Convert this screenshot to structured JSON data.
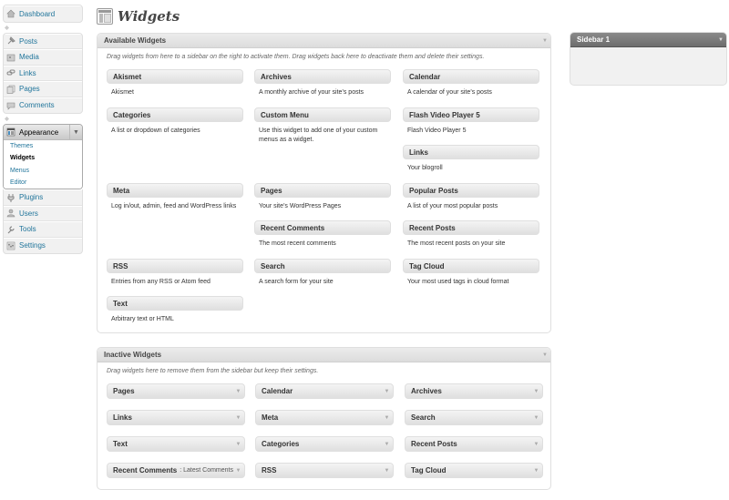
{
  "menu": {
    "dashboard": "Dashboard",
    "posts": "Posts",
    "media": "Media",
    "links": "Links",
    "pages": "Pages",
    "comments": "Comments",
    "appearance": "Appearance",
    "appearance_toggle": "▼",
    "submenu": [
      "Themes",
      "Widgets",
      "Menus",
      "Editor"
    ],
    "plugins": "Plugins",
    "users": "Users",
    "tools": "Tools",
    "settings": "Settings"
  },
  "page": {
    "title": "Widgets"
  },
  "available": {
    "title": "Available Widgets",
    "toggle": "▼",
    "description": "Drag widgets from here to a sidebar on the right to activate them. Drag widgets back here to deactivate them and delete their settings.",
    "widgets": [
      {
        "name": "Akismet",
        "desc": "Akismet"
      },
      {
        "name": "Archives",
        "desc": "A monthly archive of your site’s posts"
      },
      {
        "name": "Calendar",
        "desc": "A calendar of your site’s posts"
      },
      {
        "name": "Categories",
        "desc": "A list or dropdown of categories"
      },
      {
        "name": "Custom Menu",
        "desc": "Use this widget to add one of your custom menus as a widget."
      },
      {
        "name": "Flash Video Player 5",
        "desc": "Flash Video Player 5"
      },
      {
        "name": "Links",
        "desc": "Your blogroll"
      },
      {
        "name": "Meta",
        "desc": "Log in/out, admin, feed and WordPress links"
      },
      {
        "name": "Pages",
        "desc": "Your site’s WordPress Pages"
      },
      {
        "name": "Popular Posts",
        "desc": "A list of your most popular posts"
      },
      {
        "name": "Recent Comments",
        "desc": "The most recent comments"
      },
      {
        "name": "Recent Posts",
        "desc": "The most recent posts on your site"
      },
      {
        "name": "RSS",
        "desc": "Entries from any RSS or Atom feed"
      },
      {
        "name": "Search",
        "desc": "A search form for your site"
      },
      {
        "name": "Tag Cloud",
        "desc": "Your most used tags in cloud format"
      },
      {
        "name": "Text",
        "desc": "Arbitrary text or HTML"
      }
    ]
  },
  "inactive": {
    "title": "Inactive Widgets",
    "toggle": "▼",
    "description": "Drag widgets here to remove them from the sidebar but keep their settings.",
    "widgets": [
      {
        "name": "Pages",
        "instance": ""
      },
      {
        "name": "Calendar",
        "instance": ""
      },
      {
        "name": "Archives",
        "instance": ""
      },
      {
        "name": "Links",
        "instance": ""
      },
      {
        "name": "Meta",
        "instance": ""
      },
      {
        "name": "Search",
        "instance": ""
      },
      {
        "name": "Text",
        "instance": ""
      },
      {
        "name": "Categories",
        "instance": ""
      },
      {
        "name": "Recent Posts",
        "instance": ""
      },
      {
        "name": "Recent Comments",
        "instance": ": Latest Comments"
      },
      {
        "name": "RSS",
        "instance": ""
      },
      {
        "name": "Tag Cloud",
        "instance": ""
      }
    ],
    "arrow": "▼"
  },
  "sidebar1": {
    "title": "Sidebar 1",
    "toggle": "▼"
  }
}
